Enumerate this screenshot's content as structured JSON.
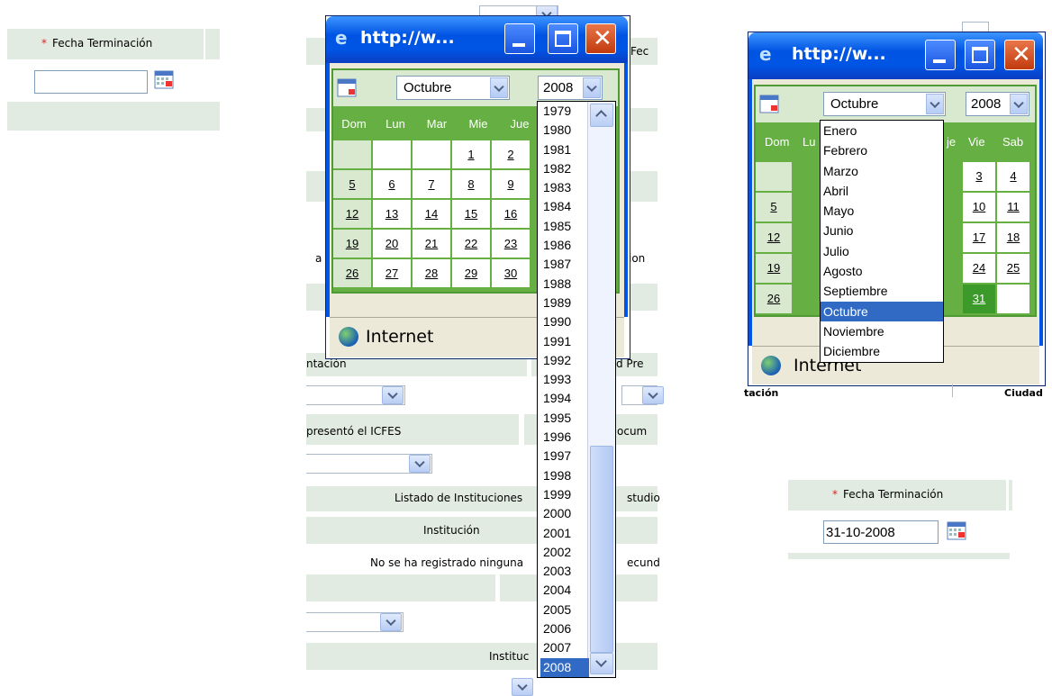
{
  "panel1": {
    "label": "Fecha Terminación",
    "required_mark": "*",
    "input_value": ""
  },
  "window2": {
    "title": "http://w...",
    "month_selected": "Octubre",
    "year_selected": "2008",
    "day_headers": [
      "Dom",
      "Lun",
      "Mar",
      "Mie",
      "Jue"
    ],
    "weeks": [
      [
        "",
        "",
        "",
        "1",
        "2"
      ],
      [
        "5",
        "6",
        "7",
        "8",
        "9"
      ],
      [
        "12",
        "13",
        "14",
        "15",
        "16"
      ],
      [
        "19",
        "20",
        "21",
        "22",
        "23"
      ],
      [
        "26",
        "27",
        "28",
        "29",
        "30"
      ]
    ],
    "status_zone": "Internet",
    "year_options": [
      "1979",
      "1980",
      "1981",
      "1982",
      "1983",
      "1984",
      "1985",
      "1986",
      "1987",
      "1988",
      "1989",
      "1990",
      "1991",
      "1992",
      "1993",
      "1994",
      "1995",
      "1996",
      "1997",
      "1998",
      "1999",
      "2000",
      "2001",
      "2002",
      "2003",
      "2004",
      "2005",
      "2006",
      "2007",
      "2008"
    ],
    "title_right_fragment": "Fec"
  },
  "background_form": {
    "presentacion": "ntación",
    "presento_icfes": "presentó el ICFES",
    "listado": "Listado de Instituciones",
    "estudio": "studio",
    "institucion": "Institución",
    "no_registrado": "No se ha registrado ninguna",
    "secundaria": "ecund",
    "instituc": "Instituc",
    "fragment_a": "a",
    "fragment_ion": "ion",
    "fragment_pre": "d Pre",
    "fragment_docum": "ocum"
  },
  "window3": {
    "title": "http://w...",
    "month_selected": "Octubre",
    "year_selected": "2008",
    "day_headers": [
      "Dom",
      "Lu",
      "",
      "",
      "je",
      "Vie",
      "Sab"
    ],
    "months": [
      "Enero",
      "Febrero",
      "Marzo",
      "Abril",
      "Mayo",
      "Junio",
      "Julio",
      "Agosto",
      "Septiembre",
      "Octubre",
      "Noviembre",
      "Diciembre"
    ],
    "right_days": [
      [
        "3",
        "4"
      ],
      [
        "10",
        "11"
      ],
      [
        "17",
        "18"
      ],
      [
        "24",
        "25"
      ],
      [
        "31",
        ""
      ]
    ],
    "left_days": [
      "",
      "5",
      "12",
      "19",
      "26"
    ],
    "status_zone": "Internet",
    "below_left": "tación",
    "below_right": "Ciudad"
  },
  "panel4": {
    "label": "Fecha Terminación",
    "required_mark": "*",
    "input_value": "31-10-2008"
  }
}
